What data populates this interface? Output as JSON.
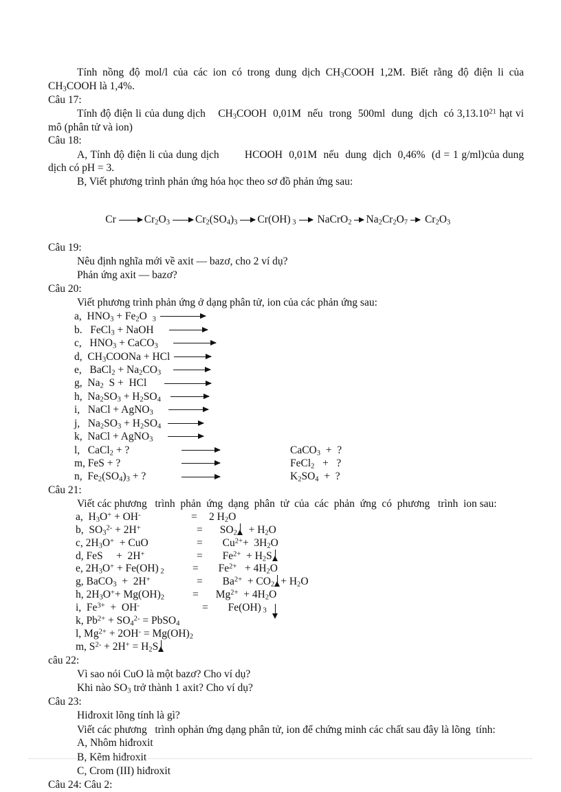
{
  "document": {
    "language": "vi",
    "background_color": "#ffffff",
    "text_color": "#111111"
  },
  "blocks": {
    "intro_para": "Tính nồng độ mol/l của các ion có trong dung dịch CH3COOH 1,2M. Biết rằng độ điện li của CH3COOH là 1,4%.",
    "cau17_label": "Câu 17:",
    "cau17_para": "Tính độ điện li của dung dịch    CH3COOH  0,01M  nếu  trong  500ml  dung  dịch  có 3,13.1021 hạt vi mô (phân tử và ion)",
    "cau18_label": "Câu 18:",
    "cau18_a": "A, Tính độ điện li của dung dịch        HCOOH  0,01M  nếu  dung  dịch  0,46%  (d = 1 g/ml)của dung dịch có pH = 3.",
    "cau18_b": "B, Viết phương   trình phản ứng hóa học theo sơ đồ phản ứng sau:",
    "cau19_label": "Câu 19:",
    "cau19_l1": "Nêu định nghĩa mới về axit — bazơ, cho 2 ví dụ?",
    "cau19_l2": "Phản ứng axit — bazơ?",
    "cau20_label": "Câu 20:",
    "cau20_para": "Viết phương   trình phản ứng  ở dạng phân tử, ion của các phản ứng sau:",
    "cau21_label": "Câu 21:",
    "cau21_para": "Viết các phương    trình  phản  ứng  dạng  phân  tử  của  các  phản  ứng  có  phương    trình  ion sau:",
    "cau22_label": "câu 22:",
    "cau22_l1": "Vì sao nói CuO là một bazơ? Cho ví dụ?",
    "cau22_l2": "Khi nào SO3 trở thành 1 axit? Cho ví dụ?",
    "cau23_label": "Câu 23:",
    "cau23_l1": "Hiđroxit lõng   tính là gì?",
    "cau23_l2": "Viết các phương   trình ophản ứng dạng phân tử, ion để chứng minh các chất sau đây là lõng  tính:",
    "cau23_a": "A, Nhôm hiđroxit",
    "cau23_b": "B, Kẽm hiđroxit",
    "cau23_c": "C, Crom (III) hiđroxit",
    "cau24_label": "Câu 24: Câu 2:"
  },
  "reaction_chain": {
    "items": [
      "Cr",
      "Cr2O3",
      "Cr2(SO4)3",
      "Cr(OH)3",
      "NaCrO2",
      "Na2Cr2O7",
      "Cr2O3"
    ],
    "arrow_widths": [
      34,
      30,
      22,
      20,
      16,
      16
    ]
  },
  "cau20_equations": [
    {
      "key": "a,",
      "lhs": "HNO3 + Fe2O  3",
      "arrow": 66,
      "rhs": ""
    },
    {
      "key": "b.",
      "lhs": " FeCl3 + NaOH",
      "arrow": 56,
      "rhs": ""
    },
    {
      "key": "c,",
      "lhs": " HNO3 + CaCO3",
      "arrow": 62,
      "rhs": ""
    },
    {
      "key": "d,",
      "lhs": " CH3COONa + HCl",
      "arrow": 54,
      "rhs": ""
    },
    {
      "key": "e,",
      "lhs": "  BaCl2 + Na2CO3",
      "arrow": 54,
      "rhs": ""
    },
    {
      "key": "g,",
      "lhs": " Na2  S +  HCl",
      "arrow": 68,
      "rhs": ""
    },
    {
      "key": "h,",
      "lhs": " Na2SO3 + H2SO4",
      "arrow": 56,
      "rhs": ""
    },
    {
      "key": "i,",
      "lhs": "  NaCl + AgNO3",
      "arrow": 58,
      "rhs": ""
    },
    {
      "key": "j,",
      "lhs": "  Na2SO3 + H2SO4",
      "arrow": 52,
      "rhs": ""
    },
    {
      "key": "k,",
      "lhs": " NaCl + AgNO3",
      "arrow": 52,
      "rhs": ""
    },
    {
      "key": "l,",
      "lhs": "  CaCl2 + ?",
      "arrow": 56,
      "rhs": "CaCO3  +  ?"
    },
    {
      "key": "m,",
      "lhs": " FeS + ?",
      "arrow": 56,
      "rhs": "FeCl2   +   ?"
    },
    {
      "key": "n,",
      "lhs": " Fe2(SO4)3 + ?",
      "arrow": 56,
      "rhs": "K2SO4  +  ?"
    }
  ],
  "cau21_equations": [
    {
      "key": "a,",
      "lhs": " H3O+ + OH-",
      "eq": "=",
      "rhs": "2 H2O",
      "mark": "none"
    },
    {
      "key": "b,",
      "lhs": " SO3^2- + 2H+",
      "eq": "=",
      "rhs": " SO2  + H2O",
      "mark": "up-after-so2"
    },
    {
      "key": "c,",
      "lhs": "2H3O+  + CuO",
      "eq": "=",
      "rhs": " Cu2+ + 3H2O",
      "mark": "none"
    },
    {
      "key": "d,",
      "lhs": "FeS     + 2H+",
      "eq": "=",
      "rhs": " Fe2+  + H2S",
      "mark": "up-end"
    },
    {
      "key": "e,",
      "lhs": "2H3O+ + Fe(OH) 2",
      "eq": "=",
      "rhs": " Fe2+   + 4H2O",
      "mark": "none"
    },
    {
      "key": "g,",
      "lhs": "BaCO3  + 2H+",
      "eq": "=",
      "rhs": " Ba2+  + CO2 + H2O",
      "mark": "up-mid"
    },
    {
      "key": "h,",
      "lhs": "2H3O++ Mg(OH)2",
      "eq": "=",
      "rhs": " Mg2+  + 4H2O",
      "mark": "none"
    },
    {
      "key": "i,",
      "lhs": " Fe3+  + OH-",
      "eq": "=",
      "rhs": " Fe(OH)3",
      "mark": "down-end"
    },
    {
      "key": "k,",
      "lhs": "Pb2+ + SO42-",
      "eq": "=",
      "rhs": "PbSO4",
      "mark": "none"
    },
    {
      "key": "l,",
      "lhs": "Mg2+ + 2OH-",
      "eq": "=",
      "rhs": "Mg(OH)2",
      "mark": "none"
    },
    {
      "key": "m,",
      "lhs": "S2- + 2H+",
      "eq": "=",
      "rhs": "H2S",
      "mark": "up-end"
    }
  ]
}
